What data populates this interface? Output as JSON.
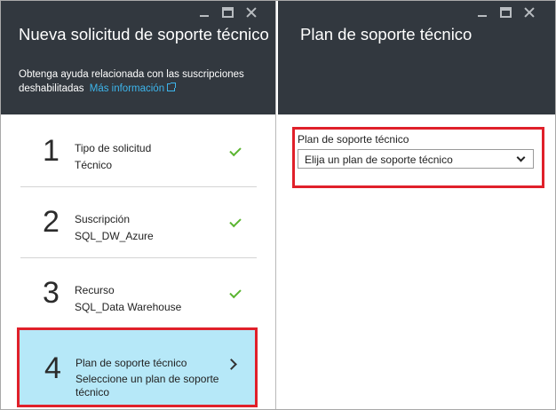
{
  "left_blade": {
    "title": "Nueva solicitud de soporte técnico",
    "description": "Obtenga ayuda relacionada con las suscripciones deshabilitadas",
    "more_info_link": "Más información",
    "steps": [
      {
        "number": "1",
        "title": "Tipo de solicitud",
        "value": "Técnico",
        "status": "complete"
      },
      {
        "number": "2",
        "title": "Suscripción",
        "value": "SQL_DW_Azure",
        "status": "complete"
      },
      {
        "number": "3",
        "title": "Recurso",
        "value": "SQL_Data Warehouse",
        "status": "complete"
      },
      {
        "number": "4",
        "title": "Plan de soporte técnico",
        "value": "Seleccione un plan de soporte técnico",
        "status": "active"
      }
    ]
  },
  "right_blade": {
    "title": "Plan de soporte técnico",
    "field_label": "Plan de soporte técnico",
    "select_value": "Elija un plan de soporte técnico"
  },
  "icons": {
    "minimize": "minimize-icon",
    "maximize": "maximize-icon",
    "close": "close-icon",
    "check": "check-icon",
    "chevron_right": "chevron-right-icon",
    "chevron_down": "chevron-down-icon",
    "external_link": "external-link-icon"
  },
  "colors": {
    "header_bg": "#32383f",
    "link": "#3db5ec",
    "active_step_bg": "#b6e8f8",
    "highlight_border": "#e0202a",
    "check": "#5bb531"
  }
}
